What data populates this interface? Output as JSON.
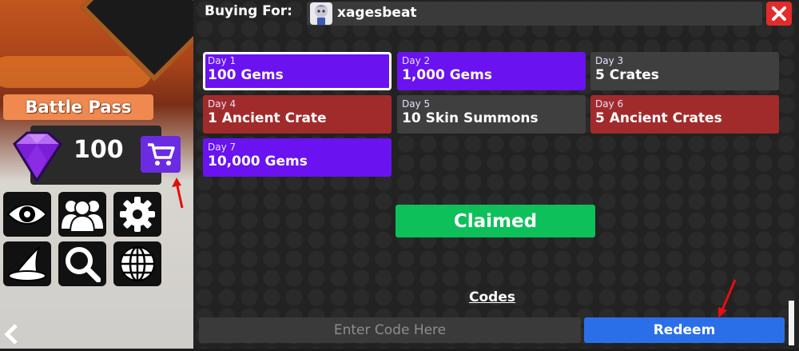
{
  "hud": {
    "battle_pass_label": "Battle Pass",
    "gems_count": "100",
    "gem_icon": "gem-icon",
    "shop_icon": "cart-icon",
    "menu_icons": [
      "eye-icon",
      "group-icon",
      "gear-icon",
      "wizard-hat-icon",
      "magnifier-icon",
      "globe-icon"
    ],
    "back_icon": "chevron-left-icon"
  },
  "purchase": {
    "buying_for_label": "Buying For:",
    "username": "xagesbeat",
    "close_icon": "close-icon"
  },
  "rewards": [
    {
      "day": "Day 1",
      "reward": "100 Gems",
      "color": "#6a12f0",
      "selected": true
    },
    {
      "day": "Day 2",
      "reward": "1,000 Gems",
      "color": "#6a12f0",
      "selected": false
    },
    {
      "day": "Day 3",
      "reward": "5 Crates",
      "color": "#3f3f3f",
      "selected": false
    },
    {
      "day": "Day 4",
      "reward": "1 Ancient Crate",
      "color": "#a12b2b",
      "selected": false
    },
    {
      "day": "Day 5",
      "reward": "10 Skin Summons",
      "color": "#3f3f3f",
      "selected": false
    },
    {
      "day": "Day 6",
      "reward": "5 Ancient Crates",
      "color": "#a12b2b",
      "selected": false
    },
    {
      "day": "Day 7",
      "reward": "10,000 Gems",
      "color": "#6a12f0",
      "selected": false
    }
  ],
  "claim_button_label": "Claimed",
  "codes": {
    "title": "Codes",
    "input_value": "",
    "input_placeholder": "Enter Code Here",
    "redeem_label": "Redeem"
  },
  "colors": {
    "claimed": "#0ec05a",
    "redeem": "#2b6fe8",
    "close": "#e32b2b",
    "annotation_arrow": "#e01010"
  }
}
